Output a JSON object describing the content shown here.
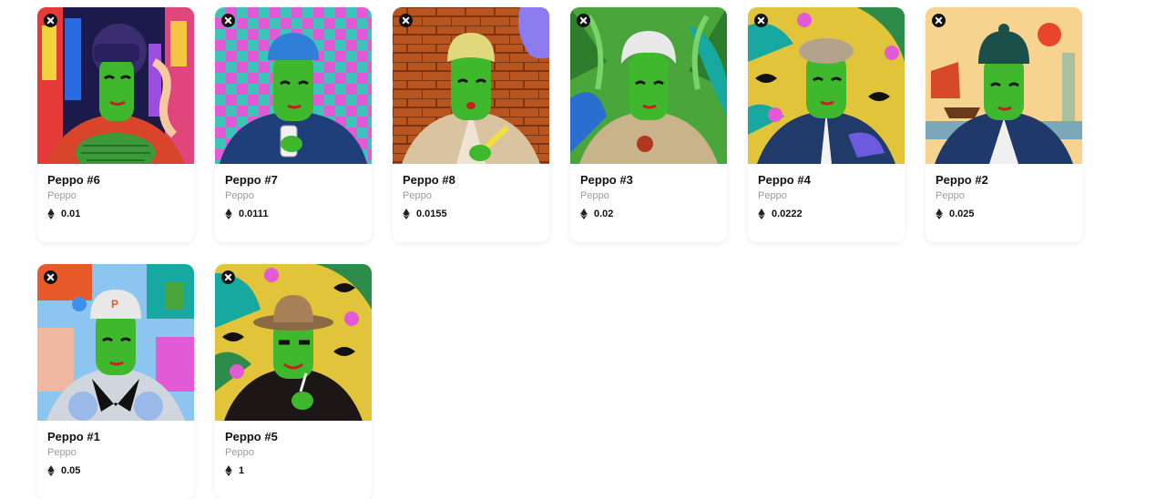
{
  "cards": [
    {
      "name": "Peppo #6",
      "collection": "Peppo",
      "price": "0.01",
      "art": "city-night"
    },
    {
      "name": "Peppo #7",
      "collection": "Peppo",
      "price": "0.0111",
      "art": "checker-phone"
    },
    {
      "name": "Peppo #8",
      "collection": "Peppo",
      "price": "0.0155",
      "art": "brick-wall"
    },
    {
      "name": "Peppo #3",
      "collection": "Peppo",
      "price": "0.02",
      "art": "jungle"
    },
    {
      "name": "Peppo #4",
      "collection": "Peppo",
      "price": "0.0222",
      "art": "shark-tie"
    },
    {
      "name": "Peppo #2",
      "collection": "Peppo",
      "price": "0.025",
      "art": "harbor-sunset"
    },
    {
      "name": "Peppo #1",
      "collection": "Peppo",
      "price": "0.05",
      "art": "cap-bandana"
    },
    {
      "name": "Peppo #5",
      "collection": "Peppo",
      "price": "1",
      "art": "bucket-hat"
    }
  ],
  "icons": {
    "chain_badge": "chain-badge-icon",
    "currency": "ethereum-icon"
  },
  "colors": {
    "skin": "#3fb82e",
    "card_background": "#ffffff",
    "name_text": "#121212",
    "collection_text": "#9a9a9a"
  }
}
